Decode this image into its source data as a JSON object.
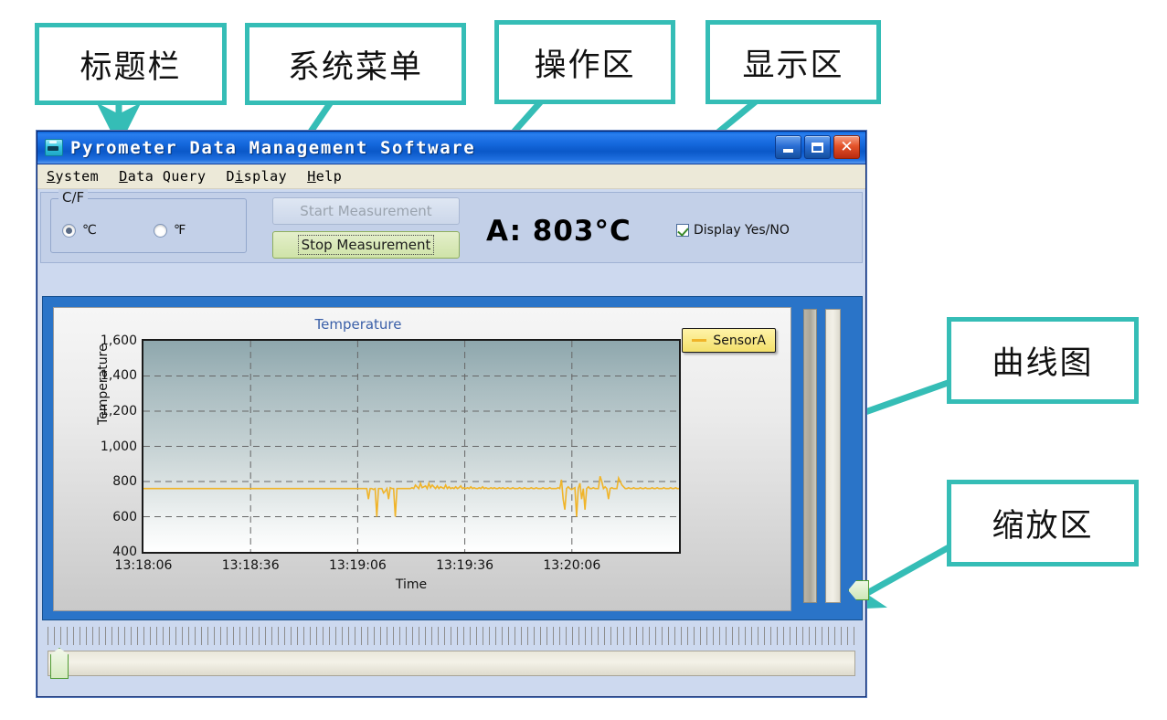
{
  "window": {
    "title": "Pyrometer Data Management Software",
    "icon": "app-icon",
    "buttons": {
      "minimize": "minimize-button",
      "maximize": "maximize-button",
      "close": "close-button"
    }
  },
  "menu": {
    "items": [
      {
        "pre": "S",
        "rest": "ystem"
      },
      {
        "pre": "D",
        "rest": "ata Query"
      },
      {
        "pre": "Di",
        "rest": "splay",
        "mid": "s"
      },
      {
        "pre": "H",
        "rest": "elp"
      }
    ],
    "labels": [
      "System",
      "Data Query",
      "Display",
      "Help"
    ]
  },
  "toolbar": {
    "cf_group_label": "C/F",
    "celsius_label": "℃",
    "fahrenheit_label": "℉",
    "celsius_selected": true,
    "fahrenheit_selected": false,
    "start_button": "Start Measurement",
    "stop_button": "Stop Measurement",
    "start_enabled": false,
    "stop_enabled": true,
    "readout": "A: 803°C",
    "display_checkbox_label": "Display Yes/NO",
    "display_checkbox_checked": true
  },
  "chart_data": {
    "type": "line",
    "title": "Temperature",
    "xlabel": "Time",
    "ylabel": "Temperature",
    "ylim": [
      400,
      1600
    ],
    "yticks": [
      1600,
      1400,
      1200,
      1000,
      800,
      600,
      400
    ],
    "ytick_labels": [
      "1,600",
      "1,400",
      "1,200",
      "1,000",
      "800",
      "600",
      "400"
    ],
    "xticks": [
      "13:18:06",
      "13:18:36",
      "13:19:06",
      "13:19:36",
      "13:20:06"
    ],
    "xlim": [
      "13:18:06",
      "13:20:36"
    ],
    "grid": true,
    "legend_position": "top-right",
    "series": [
      {
        "name": "SensorA",
        "color": "#f0b429",
        "values": [
          760,
          760,
          760,
          760,
          760,
          760,
          760,
          760,
          760,
          760,
          760,
          760,
          760,
          760,
          760,
          760,
          760,
          760,
          760,
          760,
          760,
          760,
          760,
          760,
          760,
          760,
          760,
          760,
          760,
          760,
          760,
          760,
          760,
          760,
          760,
          760,
          760,
          760,
          760,
          760,
          760,
          760,
          760,
          760,
          760,
          760,
          760,
          760,
          760,
          760,
          760,
          760,
          760,
          760,
          760,
          760,
          760,
          760,
          760,
          760,
          760,
          760,
          760,
          760,
          760,
          760,
          760,
          760,
          760,
          760,
          760,
          760,
          760,
          760,
          760,
          760,
          760,
          760,
          760,
          760,
          760,
          760,
          760,
          760,
          760,
          760,
          760,
          760,
          760,
          760,
          760,
          760,
          760,
          760,
          760,
          760,
          760,
          760,
          760,
          760,
          760,
          760,
          760,
          760,
          760,
          760,
          760,
          760,
          760,
          760,
          760,
          760,
          760,
          760,
          760,
          760,
          760,
          760,
          760,
          760,
          760,
          760,
          760,
          760,
          760,
          760,
          760,
          760,
          760,
          760,
          760,
          760,
          760,
          760,
          700,
          760,
          760,
          755,
          760,
          600,
          760,
          760,
          760,
          735,
          745,
          760,
          700,
          765,
          760,
          760,
          600,
          760,
          760,
          760,
          760,
          760,
          760,
          760,
          760,
          760,
          765,
          760,
          780,
          770,
          760,
          790,
          765,
          770,
          775,
          760,
          790,
          765,
          780,
          770,
          760,
          775,
          760,
          770,
          765,
          760,
          780,
          760,
          770,
          760,
          765,
          760,
          770,
          760,
          765,
          775,
          760,
          765,
          760,
          765,
          760,
          770,
          760,
          765,
          760,
          760,
          765,
          760,
          770,
          760,
          765,
          760,
          760,
          765,
          760,
          765,
          760,
          760,
          765,
          760,
          765,
          760,
          760,
          765,
          760,
          760,
          765,
          760,
          760,
          760,
          765,
          760,
          760,
          765,
          760,
          760,
          760,
          765,
          760,
          760,
          765,
          760,
          760,
          760,
          765,
          760,
          760,
          760,
          765,
          760,
          760,
          760,
          760,
          765,
          760,
          810,
          700,
          640,
          760,
          770,
          760,
          755,
          760,
          765,
          600,
          760,
          790,
          700,
          760,
          640,
          760,
          770,
          760,
          760,
          765,
          760,
          760,
          760,
          830,
          800,
          760,
          770,
          760,
          700,
          760,
          765,
          760,
          760,
          760,
          820,
          800,
          780,
          770,
          760,
          760,
          765,
          760,
          760,
          765,
          760,
          760,
          760,
          765,
          760,
          760,
          765,
          760,
          760,
          760,
          765,
          760,
          760,
          765,
          760,
          760,
          760,
          765,
          760,
          760,
          760,
          765,
          760,
          760,
          765,
          760,
          760
        ]
      }
    ]
  },
  "chart": {
    "legend_label": "SensorA",
    "legend_color": "#f0b429"
  },
  "zoom_controls": {
    "vertical_slider": "vertical-zoom-slider",
    "horizontal_slider": "horizontal-scroll-slider"
  },
  "annotations": [
    {
      "id": "title-bar",
      "label": "标题栏"
    },
    {
      "id": "system-menu",
      "label": "系统菜单"
    },
    {
      "id": "operation-area",
      "label": "操作区"
    },
    {
      "id": "display-area",
      "label": "显示区"
    },
    {
      "id": "curve-chart",
      "label": "曲线图"
    },
    {
      "id": "zoom-area",
      "label": "缩放区"
    }
  ],
  "colors": {
    "annotation": "#35BDB6",
    "title_bar": "#1568dd",
    "trace": "#f0b429",
    "panel_border": "#2a74c8"
  }
}
